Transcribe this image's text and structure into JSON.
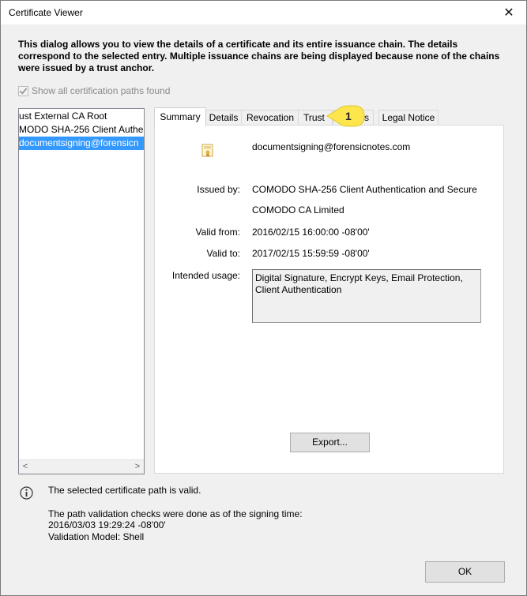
{
  "window": {
    "title": "Certificate Viewer",
    "close_glyph": "✕"
  },
  "description": "This dialog allows you to view the details of a certificate and its entire issuance chain. The details correspond to the selected entry. Multiple issuance chains are being displayed because none of the chains were issued by a trust anchor.",
  "show_all_paths": {
    "label": "Show all certification paths found",
    "checked": true,
    "disabled": true
  },
  "cert_tree": {
    "items": [
      {
        "label": "ust External CA Root",
        "selected": false
      },
      {
        "label": "MODO SHA-256 Client Authe",
        "selected": false
      },
      {
        "label": "documentsigning@forensicn",
        "selected": true
      }
    ],
    "scroll_left": "<",
    "scroll_right": ">"
  },
  "tabs": [
    {
      "label": "Summary",
      "active": true
    },
    {
      "label": "Details",
      "active": false
    },
    {
      "label": "Revocation",
      "active": false
    },
    {
      "label": "Trust",
      "active": false
    },
    {
      "label": "ies",
      "active": false
    },
    {
      "label": "Legal Notice",
      "active": false
    }
  ],
  "callout": {
    "number": "1",
    "color": "#fde54e"
  },
  "summary": {
    "subject": "documentsigning@forensicnotes.com",
    "issued_by_label": "Issued by:",
    "issued_by_line1": "COMODO SHA-256 Client Authentication and Secure",
    "issued_by_line2": "COMODO CA Limited",
    "valid_from_label": "Valid from:",
    "valid_from": "2016/02/15 16:00:00 -08'00'",
    "valid_to_label": "Valid to:",
    "valid_to": "2017/02/15 15:59:59 -08'00'",
    "intended_usage_label": "Intended usage:",
    "intended_usage": "Digital Signature, Encrypt Keys, Email Protection, Client Authentication",
    "export_label": "Export..."
  },
  "status": {
    "valid_text": "The selected certificate path is valid.",
    "validation_line1": "The path validation checks were done as of the signing time:",
    "validation_line2": "2016/03/03 19:29:24 -08'00'",
    "validation_line3": "Validation Model: Shell"
  },
  "ok_label": "OK",
  "colors": {
    "selection": "#3399ff",
    "panel_bg": "#ffffff",
    "dialog_bg": "#f0f0f0"
  }
}
